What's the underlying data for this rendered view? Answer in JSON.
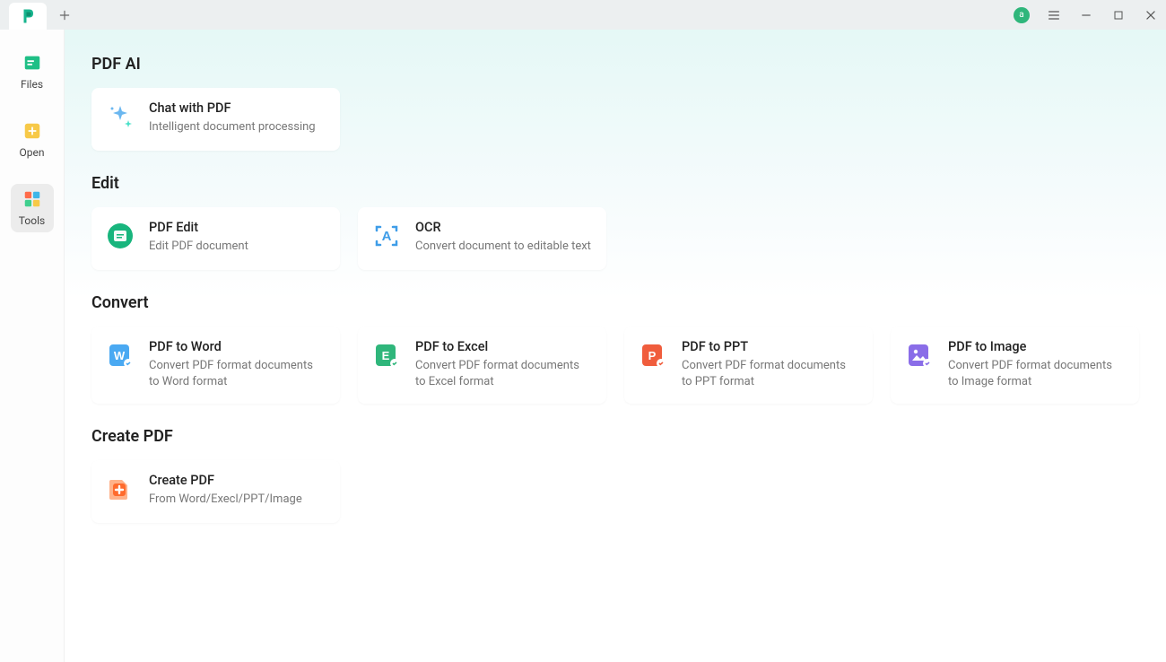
{
  "titlebar": {
    "user_initial": "a"
  },
  "sidebar": {
    "items": [
      {
        "label": "Files"
      },
      {
        "label": "Open"
      },
      {
        "label": "Tools"
      }
    ]
  },
  "sections": {
    "pdf_ai": {
      "title": "PDF AI",
      "chat": {
        "title": "Chat with PDF",
        "sub": "Intelligent document processing"
      }
    },
    "edit": {
      "title": "Edit",
      "pdf_edit": {
        "title": "PDF Edit",
        "sub": "Edit PDF document"
      },
      "ocr": {
        "title": "OCR",
        "sub": "Convert document to editable text"
      }
    },
    "convert": {
      "title": "Convert",
      "word": {
        "title": "PDF to Word",
        "sub": "Convert PDF format documents to Word format"
      },
      "excel": {
        "title": "PDF to Excel",
        "sub": "Convert PDF format documents to Excel format"
      },
      "ppt": {
        "title": "PDF to PPT",
        "sub": "Convert PDF format documents to PPT format"
      },
      "image": {
        "title": "PDF to Image",
        "sub": "Convert PDF format documents to Image format"
      }
    },
    "create": {
      "title": "Create PDF",
      "create": {
        "title": "Create PDF",
        "sub": "From Word/Execl/PPT/Image"
      }
    }
  }
}
